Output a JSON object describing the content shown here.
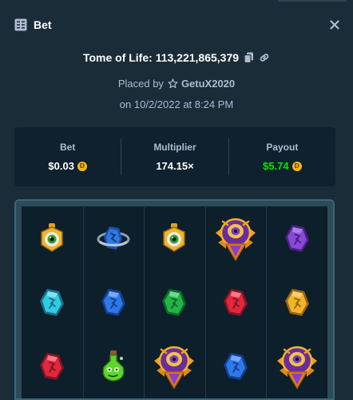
{
  "header": {
    "title": "Bet",
    "icon": "bet-list-icon",
    "close_icon": "close-icon"
  },
  "game": {
    "name": "Tome of Life",
    "separator": ": ",
    "bet_id": "113,221,865,379",
    "copy_icon": "copy-icon",
    "link_icon": "link-icon"
  },
  "placed": {
    "prefix": "Placed by",
    "star_icon": "star-icon",
    "username": "GetuX2020"
  },
  "date": {
    "text": "on 10/2/2022 at 8:24 PM"
  },
  "stats": {
    "bet": {
      "label": "Bet",
      "value": "$0.03",
      "currency_icon": "coin-icon"
    },
    "multiplier": {
      "label": "Multiplier",
      "value": "174.15×"
    },
    "payout": {
      "label": "Payout",
      "value": "$5.74",
      "currency_icon": "coin-icon"
    }
  },
  "colors": {
    "background": "#1a2c38",
    "panel": "#0f212e",
    "muted_text": "#b1bad3",
    "win_green": "#00e701",
    "coin": "#f5b516"
  },
  "board": {
    "reels": 5,
    "rows": 3,
    "symbols": [
      [
        "eye-amulet",
        "blue-rune-ring",
        "eye-amulet",
        "winged-scarab",
        "purple-rune"
      ],
      [
        "cyan-rune",
        "blue-rune",
        "green-rune",
        "red-rune",
        "gold-rune"
      ],
      [
        "red-rune",
        "green-potion",
        "winged-scarab",
        "blue-rune",
        "winged-scarab"
      ]
    ]
  }
}
